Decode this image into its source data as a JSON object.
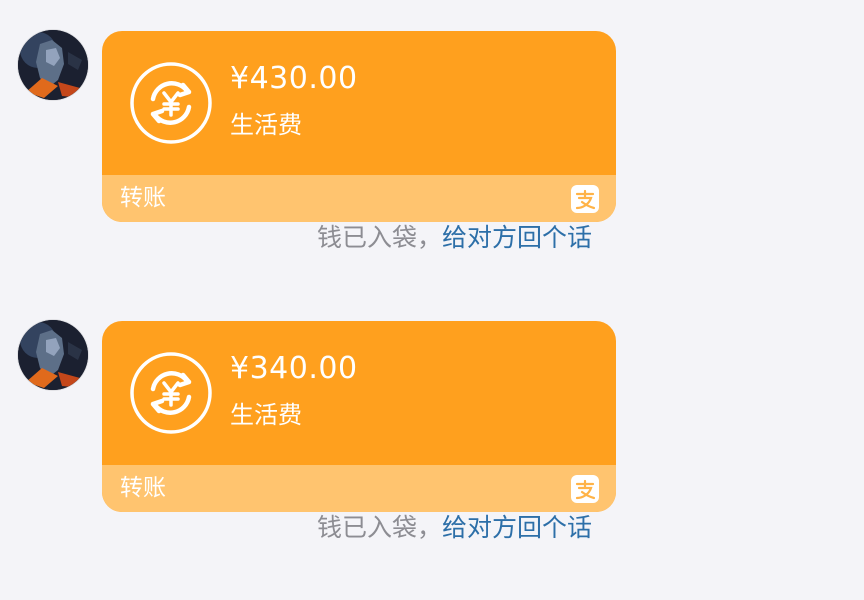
{
  "messages": [
    {
      "amount": "¥430.00",
      "note": "生活费",
      "type_label": "转账",
      "receipt_status": "钱已入袋，",
      "reply_link": "给对方回个话",
      "transfer_icon": "currency-exchange-icon",
      "brand_icon": "alipay-icon"
    },
    {
      "amount": "¥340.00",
      "note": "生活费",
      "type_label": "转账",
      "receipt_status": "钱已入袋，",
      "reply_link": "给对方回个话",
      "transfer_icon": "currency-exchange-icon",
      "brand_icon": "alipay-icon"
    }
  ],
  "colors": {
    "card_main": "#ffa01e",
    "card_footer": "#ffc46f",
    "background": "#f4f4f8",
    "status_text": "#8d8d93",
    "link": "#2d6fa8"
  }
}
